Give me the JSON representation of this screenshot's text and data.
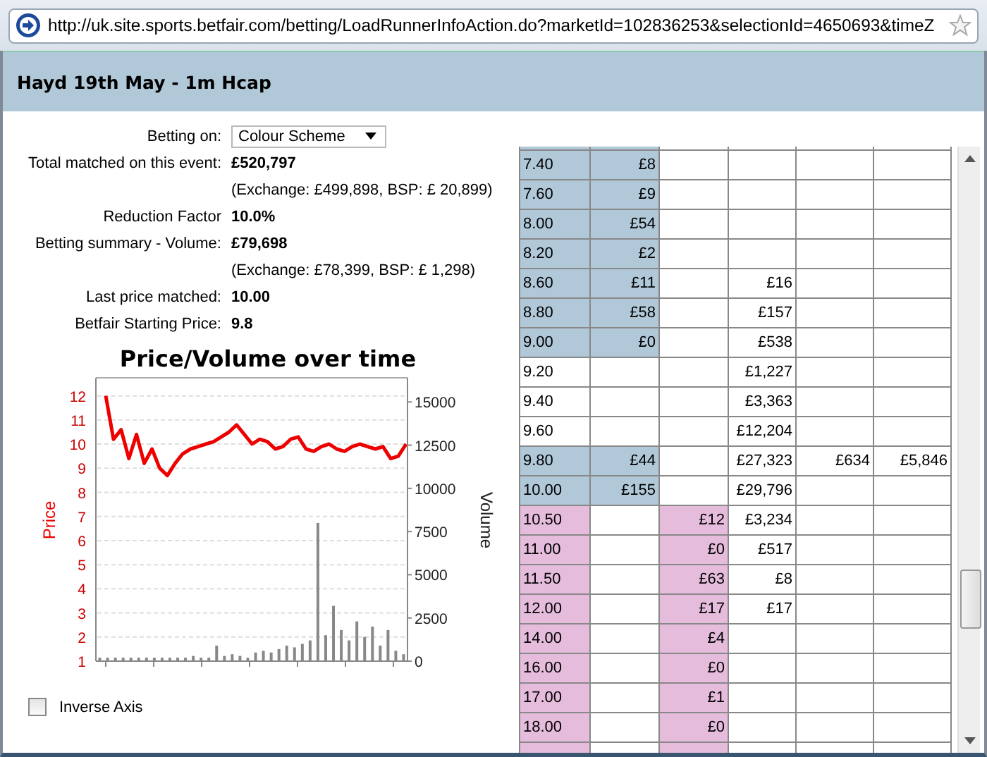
{
  "address_bar": {
    "url": "http://uk.site.sports.betfair.com/betting/LoadRunnerInfoAction.do?marketId=102836253&selectionId=4650693&timeZ"
  },
  "header": {
    "title": "Hayd 19th May - 1m Hcap"
  },
  "info": {
    "betting_on": {
      "label": "Betting on:",
      "value": "Colour Scheme"
    },
    "rows": [
      {
        "label": "Total matched on this event:",
        "value": "£520,797"
      },
      {
        "label": "",
        "value": "(Exchange: £499,898, BSP: £ 20,899)",
        "kind": "note"
      },
      {
        "label": "Reduction Factor",
        "value": "10.0%"
      },
      {
        "label": "Betting summary - Volume:",
        "value": "£79,698"
      },
      {
        "label": "",
        "value": "(Exchange: £78,399, BSP: £ 1,298)",
        "kind": "note"
      },
      {
        "label": "Last price matched:",
        "value": "10.00"
      },
      {
        "label": "Betfair Starting Price:",
        "value": "9.8"
      }
    ]
  },
  "chart": {
    "chart_data": {
      "type": "line",
      "title": "Price/Volume over time",
      "grid": true,
      "ylim": [
        1,
        12.75
      ],
      "yticks": [
        1,
        2,
        3,
        4,
        5,
        6,
        7,
        8,
        9,
        10,
        11,
        12
      ],
      "series": [
        {
          "name": "Price",
          "color": "#ee0000",
          "values": [
            12,
            10.2,
            10.6,
            9.4,
            10.4,
            9.2,
            9.8,
            9,
            8.7,
            9.2,
            9.6,
            9.8,
            9.9,
            10,
            10.1,
            10.3,
            10.5,
            10.8,
            10.4,
            10,
            10.2,
            10.1,
            9.8,
            9.9,
            10.2,
            10.3,
            9.8,
            9.7,
            9.9,
            10,
            9.8,
            9.7,
            9.9,
            10,
            9.9,
            9.8,
            9.9,
            9.4,
            9.5,
            10
          ]
        }
      ]
    }
  },
  "volume_chart": {
    "chart_data": {
      "type": "bar",
      "categories": [
        null,
        null,
        null,
        null,
        null,
        null,
        null,
        null,
        null,
        null,
        null,
        null,
        null,
        null,
        null,
        null,
        null,
        null,
        null,
        null,
        null,
        null,
        null,
        null,
        null,
        null,
        null,
        null,
        null,
        null,
        null,
        null,
        null,
        null,
        null,
        null,
        null,
        null,
        null,
        null
      ],
      "ylabel": "Volume",
      "ylim": [
        0,
        16400
      ],
      "yticks": [
        0,
        2500,
        5000,
        7500,
        10000,
        12500,
        15000
      ],
      "values": [
        200,
        200,
        200,
        200,
        200,
        200,
        200,
        200,
        200,
        200,
        200,
        200,
        300,
        200,
        200,
        900,
        300,
        400,
        300,
        200,
        500,
        600,
        500,
        700,
        900,
        800,
        1000,
        1200,
        8000,
        1500,
        3200,
        1800,
        1200,
        2300,
        1400,
        2000,
        900,
        1800,
        600,
        400
      ]
    }
  },
  "inverse_axis": {
    "label": "Inverse Axis",
    "checked": false
  },
  "ladder": {
    "rows": [
      {
        "kind": "back",
        "cells": [
          "7.40",
          "£8",
          "",
          "",
          "",
          ""
        ]
      },
      {
        "kind": "back",
        "cells": [
          "7.60",
          "£9",
          "",
          "",
          "",
          ""
        ]
      },
      {
        "kind": "back",
        "cells": [
          "8.00",
          "£54",
          "",
          "",
          "",
          ""
        ]
      },
      {
        "kind": "back",
        "cells": [
          "8.20",
          "£2",
          "",
          "",
          "",
          ""
        ]
      },
      {
        "kind": "back",
        "cells": [
          "8.60",
          "£11",
          "",
          "£16",
          "",
          ""
        ]
      },
      {
        "kind": "back",
        "cells": [
          "8.80",
          "£58",
          "",
          "£157",
          "",
          ""
        ]
      },
      {
        "kind": "back",
        "cells": [
          "9.00",
          "£0",
          "",
          "£538",
          "",
          ""
        ]
      },
      {
        "kind": "none",
        "cells": [
          "9.20",
          "",
          "",
          "£1,227",
          "",
          ""
        ]
      },
      {
        "kind": "none",
        "cells": [
          "9.40",
          "",
          "",
          "£3,363",
          "",
          ""
        ]
      },
      {
        "kind": "none",
        "cells": [
          "9.60",
          "",
          "",
          "£12,204",
          "",
          ""
        ]
      },
      {
        "kind": "back",
        "cells": [
          "9.80",
          "£44",
          "",
          "£27,323",
          "£634",
          "£5,846"
        ]
      },
      {
        "kind": "back",
        "cells": [
          "10.00",
          "£155",
          "",
          "£29,796",
          "",
          ""
        ]
      },
      {
        "kind": "lay",
        "cells": [
          "10.50",
          "",
          "£12",
          "£3,234",
          "",
          ""
        ]
      },
      {
        "kind": "lay",
        "cells": [
          "11.00",
          "",
          "£0",
          "£517",
          "",
          ""
        ]
      },
      {
        "kind": "lay",
        "cells": [
          "11.50",
          "",
          "£63",
          "£8",
          "",
          ""
        ]
      },
      {
        "kind": "lay",
        "cells": [
          "12.00",
          "",
          "£17",
          "£17",
          "",
          ""
        ]
      },
      {
        "kind": "lay",
        "cells": [
          "14.00",
          "",
          "£4",
          "",
          "",
          ""
        ]
      },
      {
        "kind": "lay",
        "cells": [
          "16.00",
          "",
          "£0",
          "",
          "",
          ""
        ]
      },
      {
        "kind": "lay",
        "cells": [
          "17.00",
          "",
          "£1",
          "",
          "",
          ""
        ]
      },
      {
        "kind": "lay",
        "cells": [
          "18.00",
          "",
          "£0",
          "",
          "",
          ""
        ]
      }
    ]
  }
}
